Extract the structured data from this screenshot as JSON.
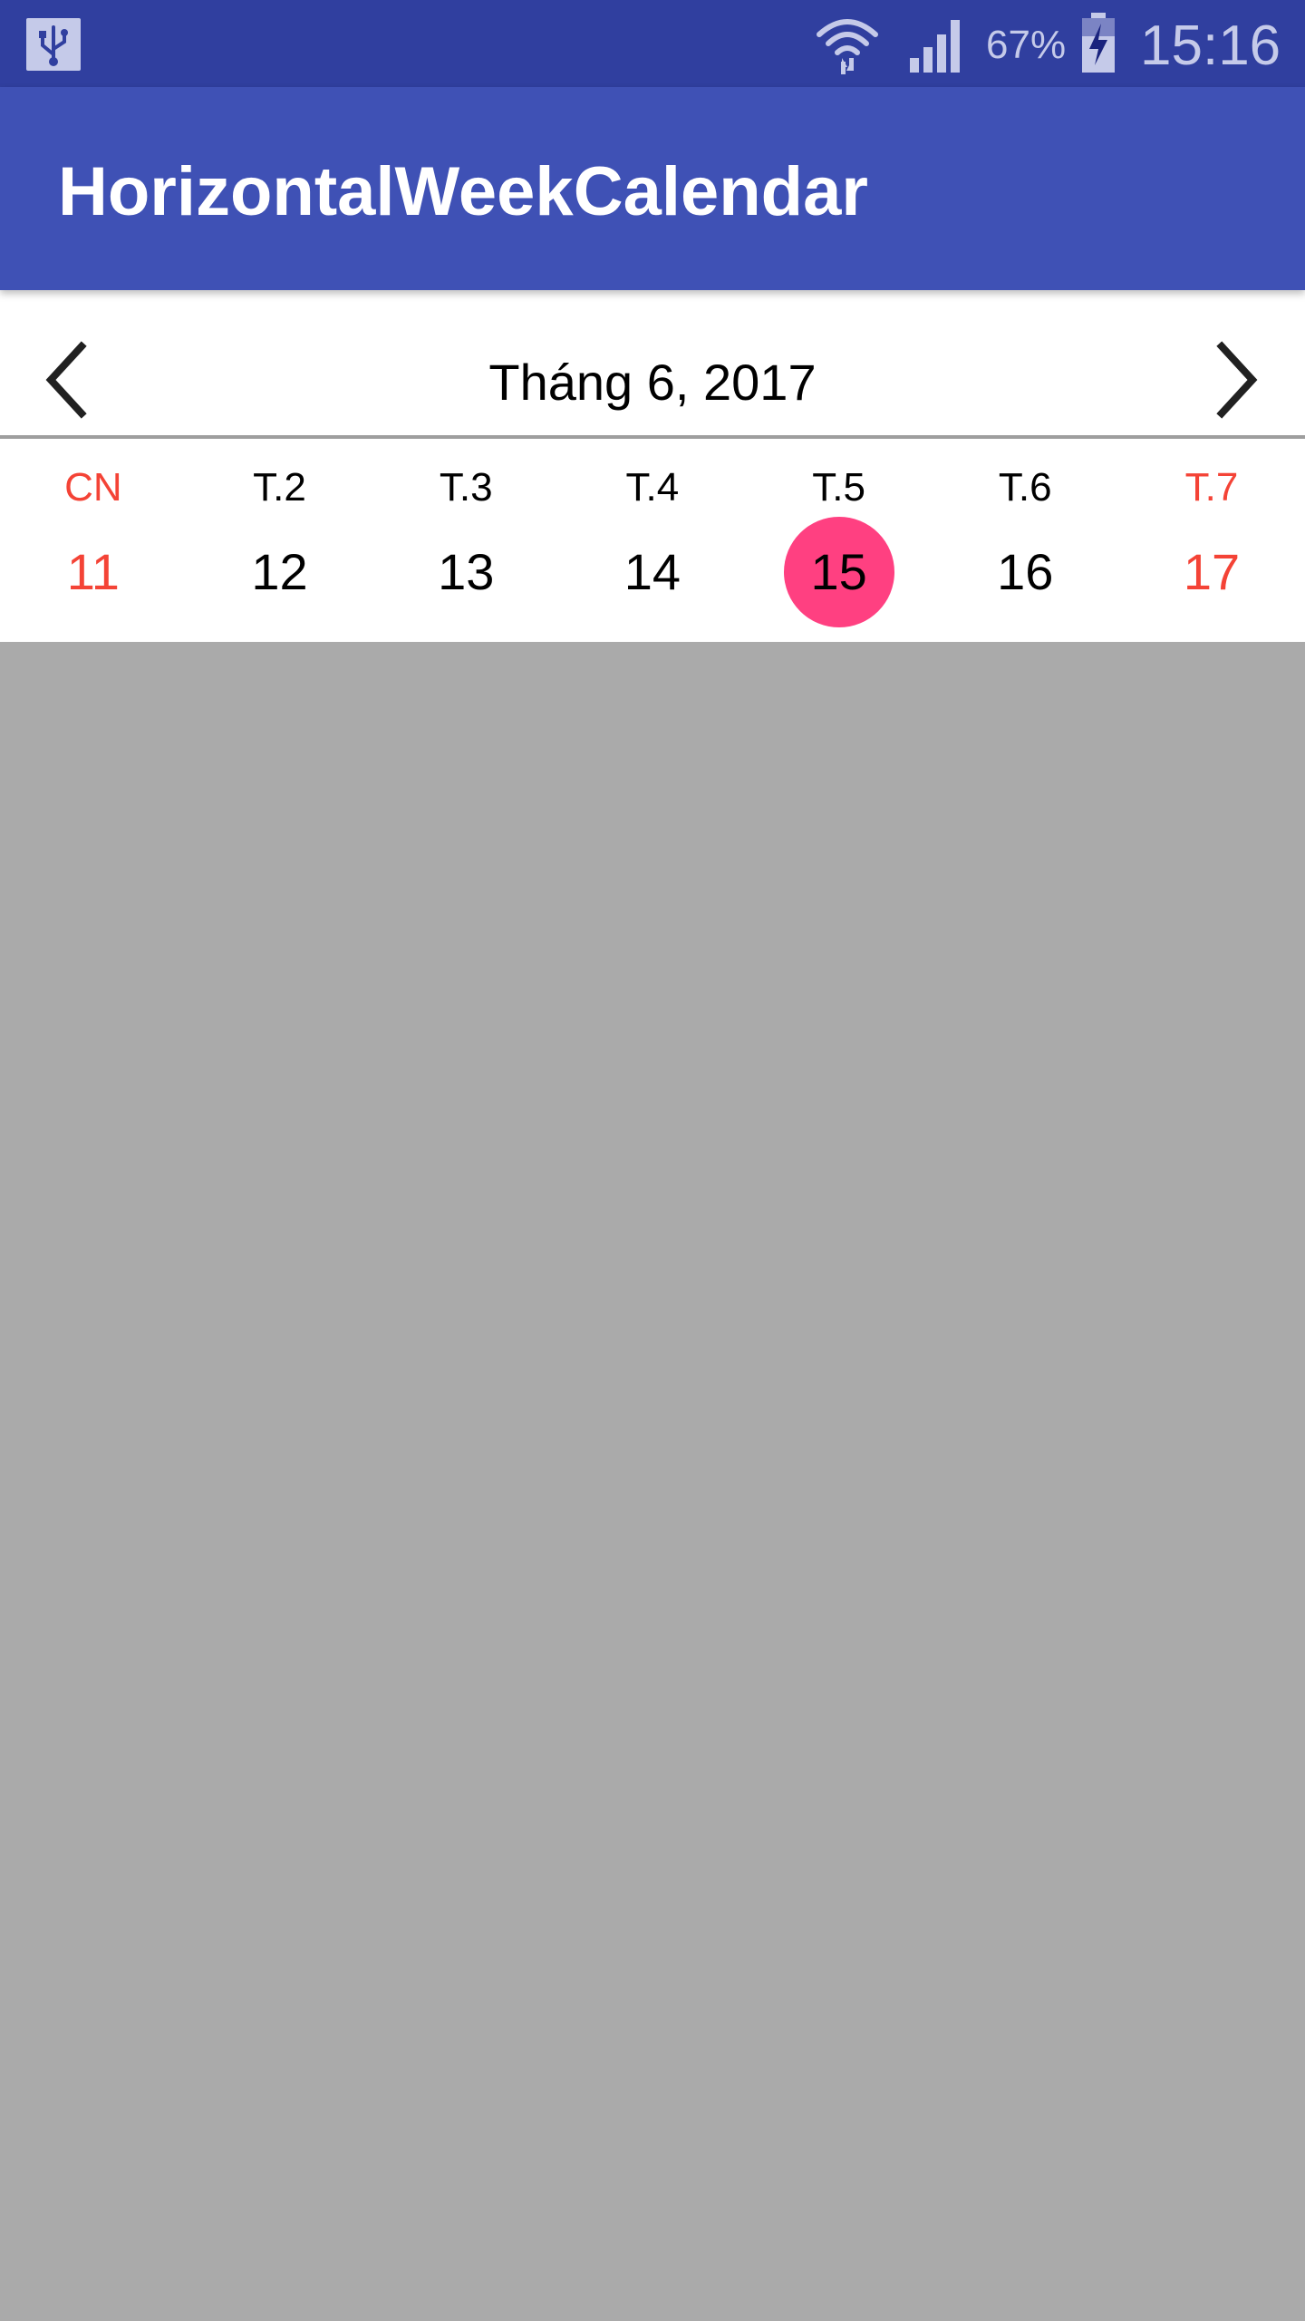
{
  "status_bar": {
    "battery_percent": "67%",
    "time": "15:16",
    "icons": [
      "usb-icon",
      "wifi-icon",
      "signal-icon",
      "battery-charging-icon"
    ]
  },
  "app_bar": {
    "title": "HorizontalWeekCalendar",
    "color": "#3f51b5"
  },
  "calendar": {
    "month_label": "Tháng 6, 2017",
    "prev_icon": "chevron-left-icon",
    "next_icon": "chevron-right-icon",
    "days": [
      {
        "name": "CN",
        "number": "11"
      },
      {
        "name": "T.2",
        "number": "12"
      },
      {
        "name": "T.3",
        "number": "13"
      },
      {
        "name": "T.4",
        "number": "14"
      },
      {
        "name": "T.5",
        "number": "15"
      },
      {
        "name": "T.6",
        "number": "16"
      },
      {
        "name": "T.7",
        "number": "17"
      }
    ],
    "selected_day": "15",
    "weekend_color": "#f44336",
    "selected_color": "#ff4081"
  }
}
